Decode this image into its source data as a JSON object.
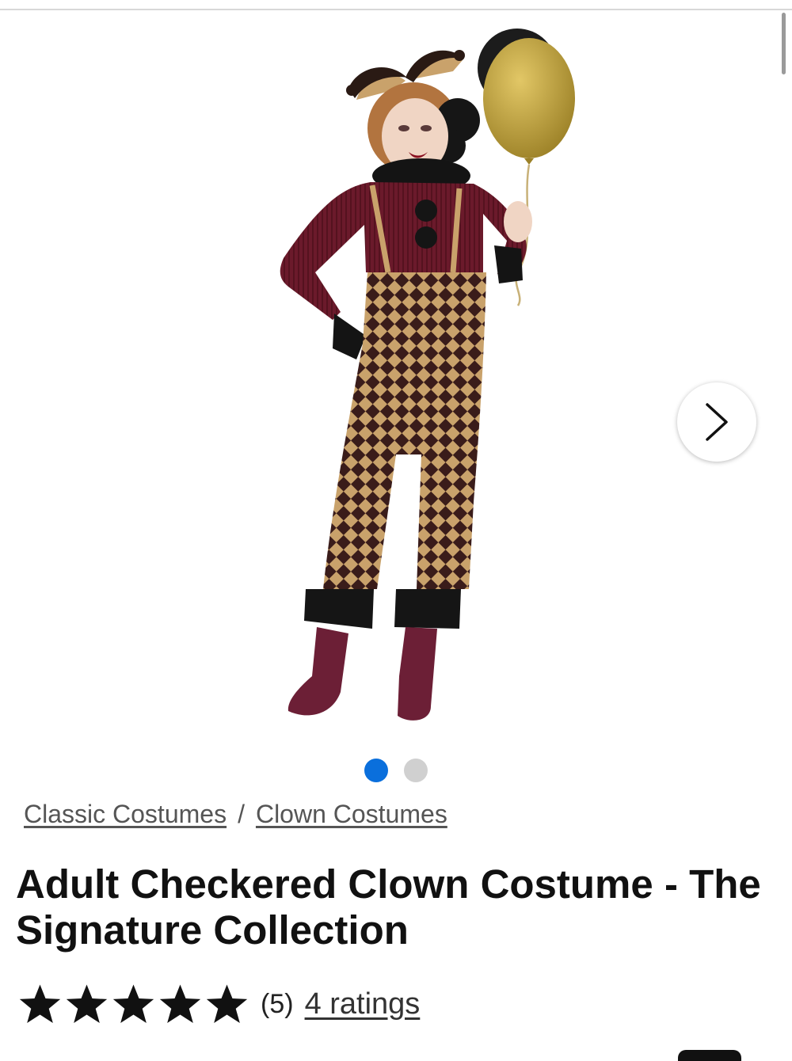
{
  "gallery": {
    "image_alt": "Adult Checkered Clown Costume - The Signature Collection",
    "next_icon": "chevron-right-icon",
    "slide_count": 2,
    "active_slide": 1,
    "colors": {
      "active_dot": "#0a6fdc",
      "inactive_dot": "#d0d0d0"
    }
  },
  "breadcrumb": {
    "items": [
      "Classic Costumes",
      "Clown Costumes"
    ],
    "separator": "/"
  },
  "product": {
    "title": "Adult Checkered Clown Costume - The Signature Collection",
    "rating": {
      "stars": 5,
      "stars_max": 5,
      "count_text": "(5)",
      "ratings_link": "4 ratings",
      "star_icon": "star-icon"
    }
  }
}
